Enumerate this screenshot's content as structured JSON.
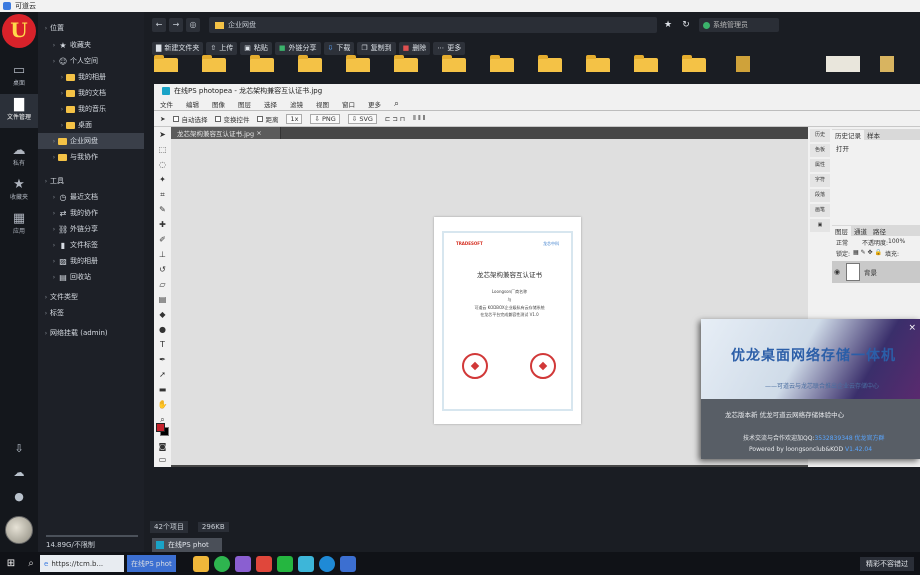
{
  "browser": {
    "title": "可道云"
  },
  "rail": {
    "logo": "U",
    "items": [
      {
        "icon": "monitor-icon",
        "glyph": "▭",
        "label": "桌面"
      },
      {
        "icon": "folder-icon",
        "glyph": "▇",
        "label": "文件管理"
      },
      {
        "icon": "cloud-icon",
        "glyph": "☁",
        "label": "私有"
      },
      {
        "icon": "star-icon",
        "glyph": "★",
        "label": "收藏夹"
      },
      {
        "icon": "apps-icon",
        "glyph": "▦",
        "label": "应用"
      }
    ]
  },
  "tree": {
    "items": [
      {
        "level": 0,
        "label": "位置",
        "type": "header"
      },
      {
        "level": 1,
        "label": "收藏夹",
        "type": "star"
      },
      {
        "level": 1,
        "label": "个人空间",
        "type": "user"
      },
      {
        "level": 2,
        "label": "我的相册",
        "type": "folder"
      },
      {
        "level": 2,
        "label": "我的文档",
        "type": "folder"
      },
      {
        "level": 2,
        "label": "我的音乐",
        "type": "folder"
      },
      {
        "level": 2,
        "label": "桌面",
        "type": "folder"
      },
      {
        "level": 1,
        "label": "企业网盘",
        "type": "folder",
        "selected": true
      },
      {
        "level": 1,
        "label": "与我协作",
        "type": "folder"
      },
      {
        "level": 0,
        "label": "工具",
        "type": "header"
      },
      {
        "level": 1,
        "label": "最近文档",
        "type": "clock"
      },
      {
        "level": 1,
        "label": "我的协作",
        "type": "share"
      },
      {
        "level": 1,
        "label": "外链分享",
        "type": "link"
      },
      {
        "level": 1,
        "label": "文件标签",
        "type": "tag"
      },
      {
        "level": 1,
        "label": "我的相册",
        "type": "image"
      },
      {
        "level": 1,
        "label": "回收站",
        "type": "trash"
      },
      {
        "level": 0,
        "label": "文件类型",
        "type": "header"
      },
      {
        "level": 0,
        "label": "标签",
        "type": "header"
      },
      {
        "level": 0,
        "label": "网络挂载 (admin)",
        "type": "header"
      }
    ],
    "storage": "14.89G/不限制"
  },
  "explorer": {
    "path": "企业网盘",
    "user": "系统管理员",
    "toolbar": [
      {
        "icon": "folder-plus-icon",
        "label": "新建文件夹"
      },
      {
        "icon": "upload-icon",
        "label": "上传"
      },
      {
        "icon": "paste-icon",
        "label": "粘贴"
      },
      {
        "icon": "share-icon",
        "label": "外链分享"
      },
      {
        "icon": "download-icon",
        "label": "下载"
      },
      {
        "icon": "copy-icon",
        "label": "复制到"
      },
      {
        "icon": "delete-icon",
        "label": "删除"
      },
      {
        "icon": "more-icon",
        "label": "更多"
      }
    ],
    "status_count": "42个项目",
    "status_size": "296KB"
  },
  "photopea": {
    "title": "在线PS photopea - 龙芯架构兼容互认证书.jpg",
    "menu": [
      "文件",
      "编辑",
      "图像",
      "图层",
      "选择",
      "滤镜",
      "视图",
      "窗口",
      "更多"
    ],
    "options": [
      "自动选择",
      "变换控件",
      "距离",
      "1x",
      "PNG",
      "SVG"
    ],
    "tab": "龙芯架构兼容互认证书.jpg",
    "right_icons": [
      "历史",
      "色板",
      "属性",
      "字符",
      "段落",
      "画笔"
    ],
    "panel_tabs_top": [
      "历史记录",
      "样本"
    ],
    "panel_top_item": "打开",
    "panel_tabs_layers": [
      "图层",
      "通道",
      "路径"
    ],
    "blend_mode": "正常",
    "opacity_label": "不透明度:",
    "opacity": "100%",
    "lock_label": "锁定:",
    "fill_label": "填充:",
    "layer_name": "背景",
    "cert": {
      "logo": "TRADESOFT",
      "partner": "龙芯中科",
      "title": "龙芯架构兼容互认证书",
      "company": "Loongson厂商名称",
      "and": "与",
      "product_line1": "可道云 KODBOX企业级私有云存储系统",
      "product_line2": "在龙芯平台完成兼容性测试 V1.0"
    }
  },
  "popup": {
    "title": "优龙桌面网络存储一体机",
    "subtitle": "——可道云与龙芯联合推出企业云存储中心",
    "line1": "龙芯版本新 优龙可道云网络存储体验中心",
    "line2_prefix": "技术交流与合作欢迎加QQ:",
    "line2_qq": "3532839348 优龙官方群",
    "line3_prefix": "Powered by loongsonclub&KOD",
    "line3_ver": "V1.42.04"
  },
  "taskbar": {
    "search_app": "https://tcm.b...",
    "active_app": "在线PS phot",
    "apps": [
      "explorer",
      "browser",
      "photos",
      "media",
      "wechat",
      "edge",
      "store"
    ],
    "tray": "精彩不容错过"
  },
  "colors": {
    "accent": "#f4c246",
    "brand": "#d8222a",
    "selection": "#3a3f49"
  }
}
